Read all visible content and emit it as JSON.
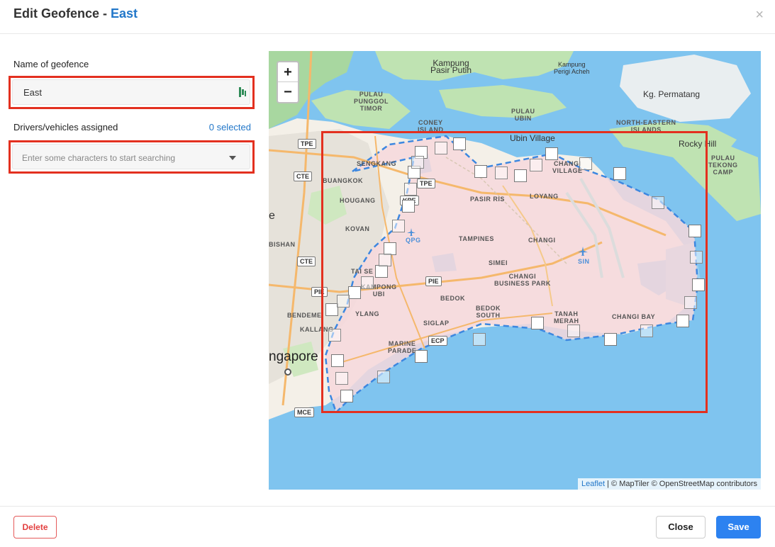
{
  "header": {
    "title_prefix": "Edit Geofence - ",
    "title_name": "East",
    "close_glyph": "×"
  },
  "form": {
    "name_label": "Name of geofence",
    "name_value": "East",
    "drivers_label": "Drivers/vehicles assigned",
    "selected_count": "0 selected",
    "search_placeholder": "Enter some characters to start searching"
  },
  "map": {
    "zoom_in": "+",
    "zoom_out": "−",
    "attribution_leaflet": "Leaflet",
    "attribution_rest": " | © MapTiler © OpenStreetMap contributors",
    "labels": {
      "kampung_pasir_putih": "Kampung\nPasir Putih",
      "kampung_perigi": "Kampung\nPerigi Acheh",
      "kg_permatang": "Kg. Permatang",
      "pulau_punggol": "PULAU\nPUNGGOL\nTIMOR",
      "pulau_ubin": "PULAU\nUBIN",
      "coney_island": "CONEY\nISLAND",
      "ubin_village": "Ubin Village",
      "north_eastern": "NORTH-EASTERN\nISLANDS",
      "rocky_hill": "Rocky Hill",
      "pulau_tekong": "PULAU\nTEKONG\nCAMP",
      "sengkang": "SENGKANG",
      "buangkok": "BUANGKOK",
      "hougang": "HOUGANG",
      "kovan": "KOVAN",
      "bishan": "BISHAN",
      "tai_seng": "TAI SE",
      "kampong_ubi": "KAMPONG\nUBI",
      "bendemeer": "BENDEME",
      "kallang": "KALLANG",
      "geylang": "YLANG",
      "marine_parade": "MARINE\nPARADE",
      "pasir_ris": "PASIR RIS",
      "loyang": "LOYANG",
      "changi_village": "CHANGI\nVILLAGE",
      "tampines": "TAMPINES",
      "changi": "CHANGI",
      "simei": "SIMEI",
      "changi_business_park": "CHANGI\nBUSINESS PARK",
      "bedok": "BEDOK",
      "bedok_south": "BEDOK\nSOUTH",
      "siglap": "SIGLAP",
      "tanah_merah": "TANAH\nMERAH",
      "changi_bay": "CHANGI BAY",
      "singapore": "ngapore",
      "qpg": "QPG",
      "sin": "SIN",
      "e": "e"
    },
    "shields": {
      "tpe1": "TPE",
      "cte1": "CTE",
      "tpe2": "TPE",
      "kpe": "KPE",
      "cte2": "CTE",
      "pie1": "PIE",
      "pie2": "PIE",
      "ecp": "ECP",
      "mce": "MCE"
    }
  },
  "footer": {
    "delete_label": "Delete",
    "close_label": "Close",
    "save_label": "Save"
  },
  "colors": {
    "accent": "#2277c9",
    "primary_button": "#2d82f0",
    "danger": "#e34040",
    "highlight_box": "#e3301f",
    "water": "#7fc4ef",
    "geofence_fill": "#f6d8dc"
  }
}
